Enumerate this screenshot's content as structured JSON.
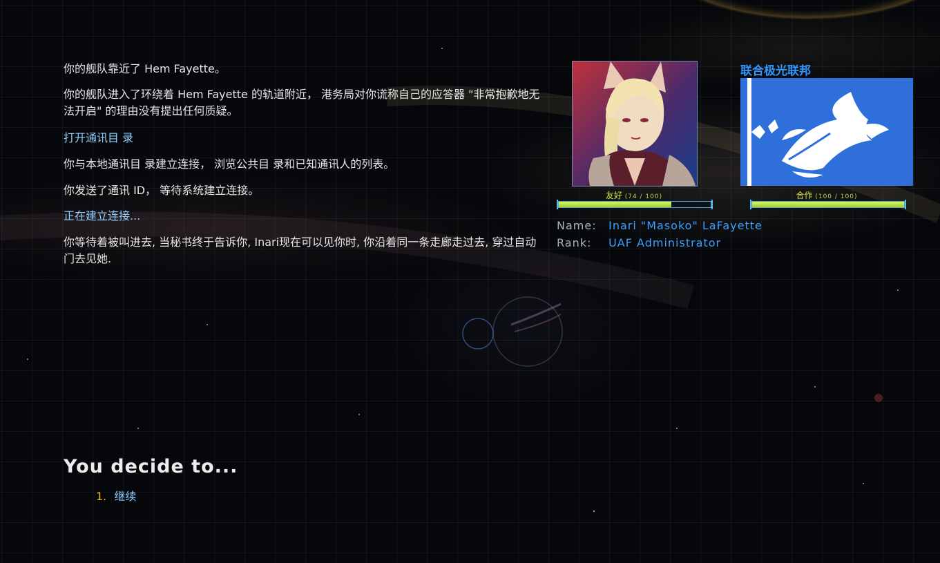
{
  "story": {
    "p1": "你的舰队靠近了 Hem Fayette。",
    "p2": "你的舰队进入了环绕着 Hem Fayette 的轨道附近， 港务局对你谎称自己的应答器 \"非常抱歉地无法开启\" 的理由没有提出任何质疑。",
    "p3": "打开通讯目 录",
    "p4": "你与本地通讯目 录建立连接， 浏览公共目 录和已知通讯人的列表。",
    "p5": "你发送了通讯 ID， 等待系统建立连接。",
    "p6": "正在建立连接...",
    "p7": " 你等待着被叫进去, 当秘书终于告诉你, Inari现在可以见你时, 你沿着同一条走廊走过去, 穿过自动门去见她."
  },
  "choices": {
    "title": "You decide to...",
    "items": [
      {
        "num": "1.",
        "label": "继续"
      }
    ]
  },
  "faction": {
    "name": "联合极光联邦"
  },
  "relations": {
    "personal": {
      "label": "友好",
      "value": "(74 / 100)",
      "fraction": 0.74
    },
    "faction": {
      "label": "合作",
      "value": "(100 / 100)",
      "fraction": 1.0
    }
  },
  "character": {
    "name_label": "Name:",
    "name_value": "Inari \"Masoko\" LaFayette",
    "rank_label": "Rank:",
    "rank_value": "UAF Administrator"
  },
  "colors": {
    "link": "#8fd0ff",
    "accent_blue": "#3aa0ff",
    "choice_number": "#f0b81c",
    "bar_fill": "#c6ec4e",
    "flag_bg": "#2f6fd9"
  }
}
